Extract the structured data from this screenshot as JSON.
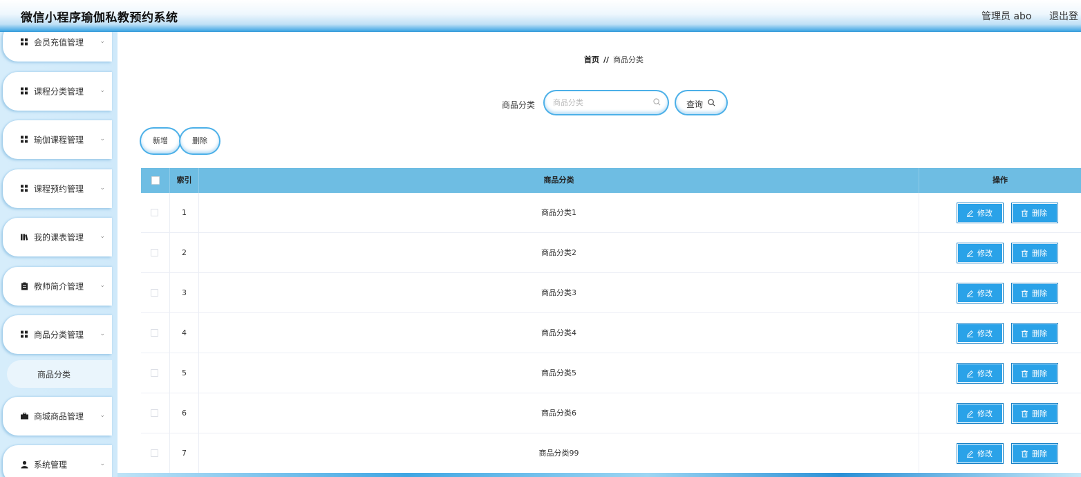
{
  "header": {
    "title": "微信小程序瑜伽私教预约系统",
    "user": "管理员 abo",
    "logout": "退出登"
  },
  "sidebar": {
    "items": [
      {
        "label": "会员充值管理",
        "icon": "grid-icon"
      },
      {
        "label": "课程分类管理",
        "icon": "grid-icon"
      },
      {
        "label": "瑜伽课程管理",
        "icon": "grid-icon"
      },
      {
        "label": "课程预约管理",
        "icon": "grid-icon"
      },
      {
        "label": "我的课表管理",
        "icon": "book-icon"
      },
      {
        "label": "教师简介管理",
        "icon": "clipboard-icon"
      },
      {
        "label": "商品分类管理",
        "icon": "grid-icon"
      },
      {
        "label": "商城商品管理",
        "icon": "briefcase-icon"
      },
      {
        "label": "系统管理",
        "icon": "user-icon"
      }
    ],
    "submenu": {
      "label": "商品分类"
    }
  },
  "breadcrumb": {
    "home": "首页",
    "separator": "//",
    "current": "商品分类"
  },
  "search": {
    "label": "商品分类",
    "placeholder": "商品分类",
    "value": "",
    "button": "查询"
  },
  "actions": {
    "add": "新增",
    "delete": "删除"
  },
  "table": {
    "headers": {
      "index": "索引",
      "name": "商品分类",
      "ops": "操作"
    },
    "rows": [
      {
        "index": "1",
        "name": "商品分类1"
      },
      {
        "index": "2",
        "name": "商品分类2"
      },
      {
        "index": "3",
        "name": "商品分类3"
      },
      {
        "index": "4",
        "name": "商品分类4"
      },
      {
        "index": "5",
        "name": "商品分类5"
      },
      {
        "index": "6",
        "name": "商品分类6"
      },
      {
        "index": "7",
        "name": "商品分类99"
      }
    ],
    "row_actions": {
      "edit": "修改",
      "remove": "删除"
    }
  },
  "colors": {
    "accent": "#2aa2e8",
    "header_row": "#6ebde3",
    "sidebar_bg": "#d6edfb"
  }
}
